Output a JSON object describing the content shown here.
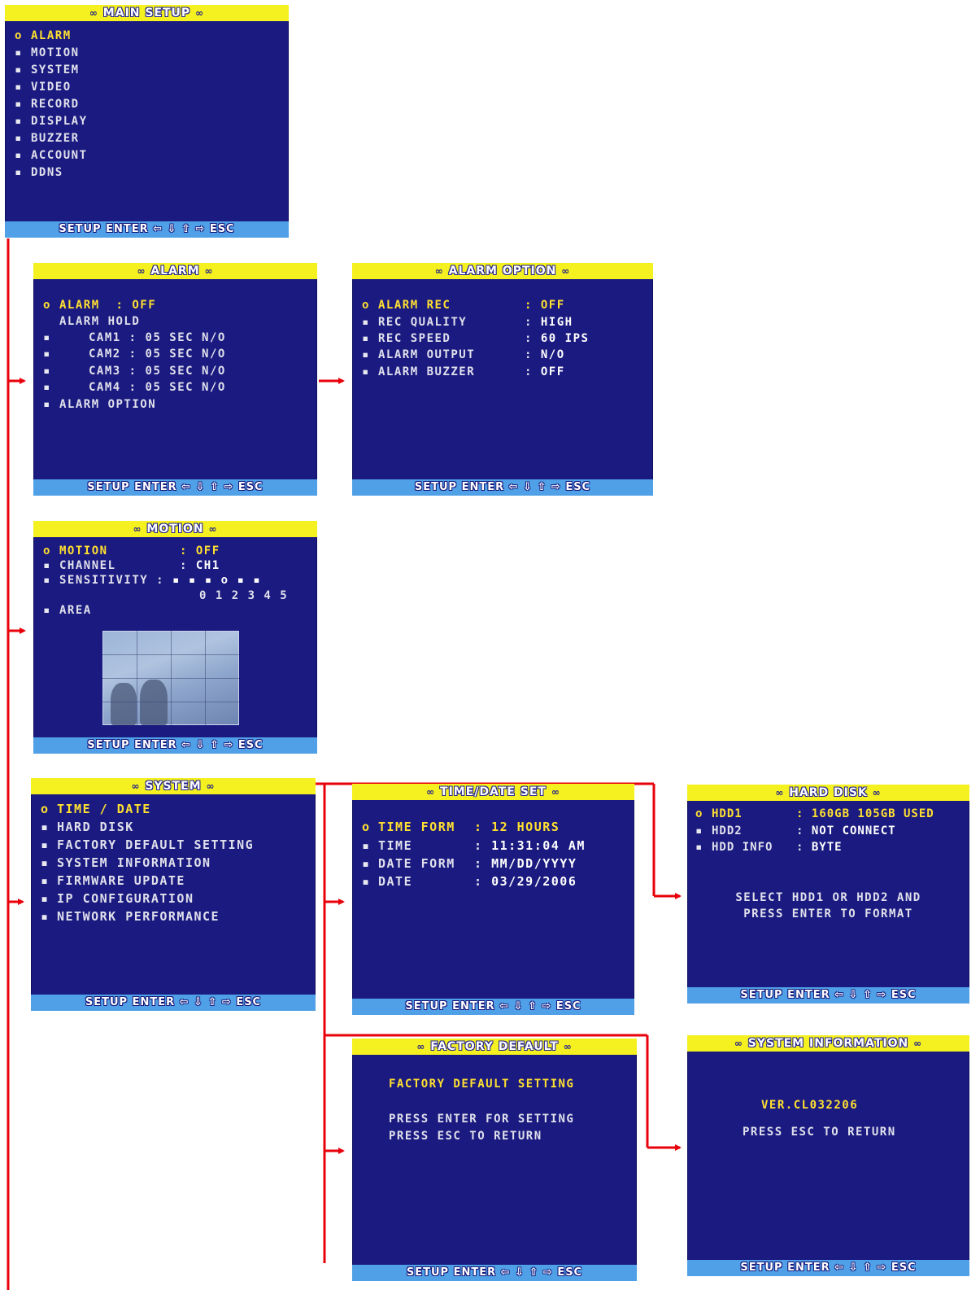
{
  "colors": {
    "screen_bg": "#1a1a80",
    "title_bar": "#f5f020",
    "footer_bar": "#4fa0e6",
    "highlight": "#ffe030",
    "connector": "#e8000a"
  },
  "icons": {
    "selected_marker": "o",
    "item_marker": "▪",
    "arrow": "red-arrow-icon"
  },
  "footer": "SETUP ENTER ⇦ ⇩ ⇧ ⇨ ESC",
  "title_deco": "∞",
  "main_setup": {
    "title": "MAIN SETUP",
    "items": [
      "ALARM",
      "MOTION",
      "SYSTEM",
      "VIDEO",
      "RECORD",
      "DISPLAY",
      "BUZZER",
      "ACCOUNT",
      "DDNS"
    ]
  },
  "alarm": {
    "title": "ALARM",
    "alarm_label": "ALARM",
    "alarm_value": "OFF",
    "hold_label": "ALARM HOLD",
    "cams": [
      {
        "label": "CAM1 :",
        "time": "05 SEC",
        "mode": "N/O"
      },
      {
        "label": "CAM2 :",
        "time": "05 SEC",
        "mode": "N/O"
      },
      {
        "label": "CAM3 :",
        "time": "05 SEC",
        "mode": "N/O"
      },
      {
        "label": "CAM4 :",
        "time": "05 SEC",
        "mode": "N/O"
      }
    ],
    "option_label": "ALARM OPTION"
  },
  "alarm_option": {
    "title": "ALARM OPTION",
    "rows": [
      {
        "label": "ALARM REC",
        "value": "OFF"
      },
      {
        "label": "REC QUALITY",
        "value": "HIGH"
      },
      {
        "label": "REC SPEED",
        "value": "60 IPS"
      },
      {
        "label": "ALARM OUTPUT",
        "value": "N/O"
      },
      {
        "label": "ALARM BUZZER",
        "value": "OFF"
      }
    ]
  },
  "motion": {
    "title": "MOTION",
    "motion_label": "MOTION",
    "motion_value": "OFF",
    "channel_label": "CHANNEL",
    "channel_value": "CH1",
    "sensitivity_label": "SENSITIVITY :",
    "sensitivity_markers": "▪ ▪ ▪ o ▪ ▪",
    "sensitivity_scale": "0 1 2 3 4 5",
    "area_label": "AREA"
  },
  "system": {
    "title": "SYSTEM",
    "items": [
      "TIME / DATE",
      "HARD DISK",
      "FACTORY DEFAULT SETTING",
      "SYSTEM INFORMATION",
      "FIRMWARE UPDATE",
      "IP CONFIGURATION",
      "NETWORK PERFORMANCE"
    ]
  },
  "time_date": {
    "title": "TIME/DATE SET",
    "rows": [
      {
        "label": "TIME FORM",
        "value": "12 HOURS"
      },
      {
        "label": "TIME",
        "value": "11:31:04 AM"
      },
      {
        "label": "DATE FORM",
        "value": "MM/DD/YYYY"
      },
      {
        "label": "DATE",
        "value": "03/29/2006"
      }
    ]
  },
  "hard_disk": {
    "title": "HARD DISK",
    "rows": [
      {
        "label": "HDD1",
        "value": "160GB 105GB USED"
      },
      {
        "label": "HDD2",
        "value": "NOT CONNECT"
      },
      {
        "label": "HDD INFO",
        "value": "BYTE"
      }
    ],
    "message1": "SELECT HDD1 OR HDD2 AND",
    "message2": "PRESS ENTER TO FORMAT"
  },
  "factory_default": {
    "title": "FACTORY DEFAULT",
    "heading": "FACTORY DEFAULT SETTING",
    "line1": "PRESS ENTER FOR SETTING",
    "line2": "PRESS ESC TO RETURN"
  },
  "system_info": {
    "title": "SYSTEM INFORMATION",
    "version": "VER.CL032206",
    "line": "PRESS ESC TO RETURN"
  }
}
